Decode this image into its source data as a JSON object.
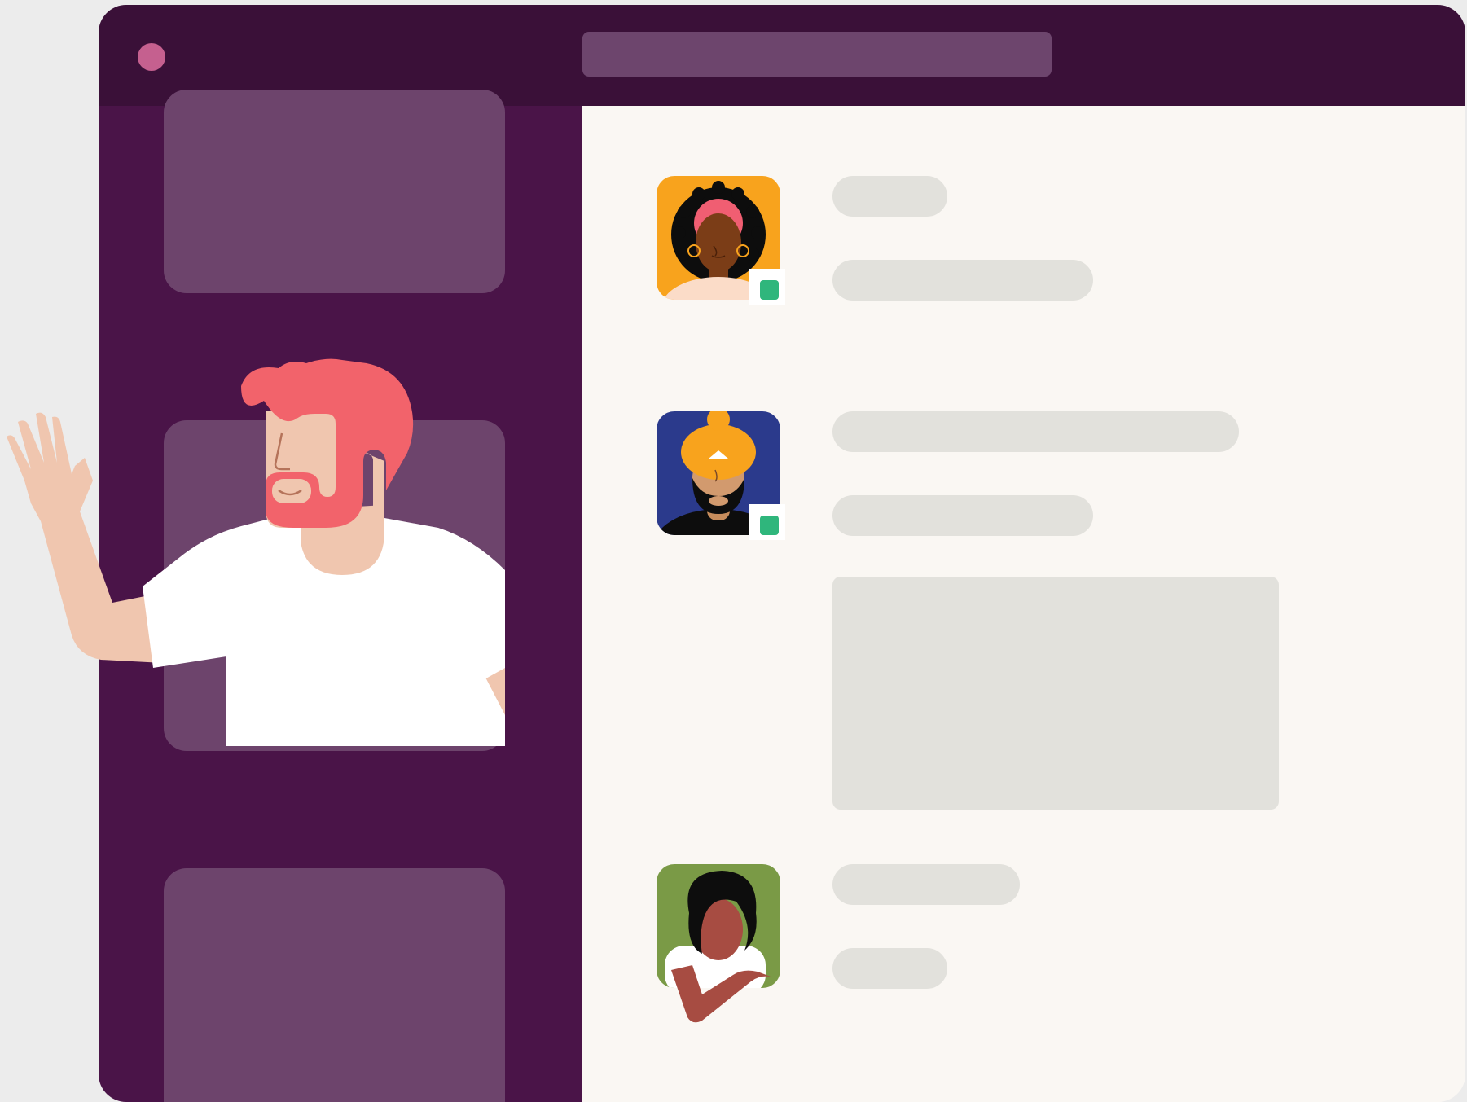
{
  "theme": {
    "titlebar": "#3a1038",
    "sidebar": "#4a1448",
    "sidebar_tile": "#6d446c",
    "main_background": "#faf7f3",
    "placeholder": "#e2e1dc",
    "presence": "#2fb67c"
  },
  "titlebar": {
    "search": {
      "value": "",
      "placeholder": ""
    }
  },
  "messages": [
    {
      "avatar": "woman-curly-hair-avatar",
      "avatar_background": "#f8a31d",
      "presence": "online"
    },
    {
      "avatar": "man-turban-avatar",
      "avatar_background": "#2b3a8c",
      "presence": "online"
    },
    {
      "avatar": "woman-wavy-hair-avatar",
      "avatar_background": "#7a9a46",
      "presence": "none"
    }
  ]
}
